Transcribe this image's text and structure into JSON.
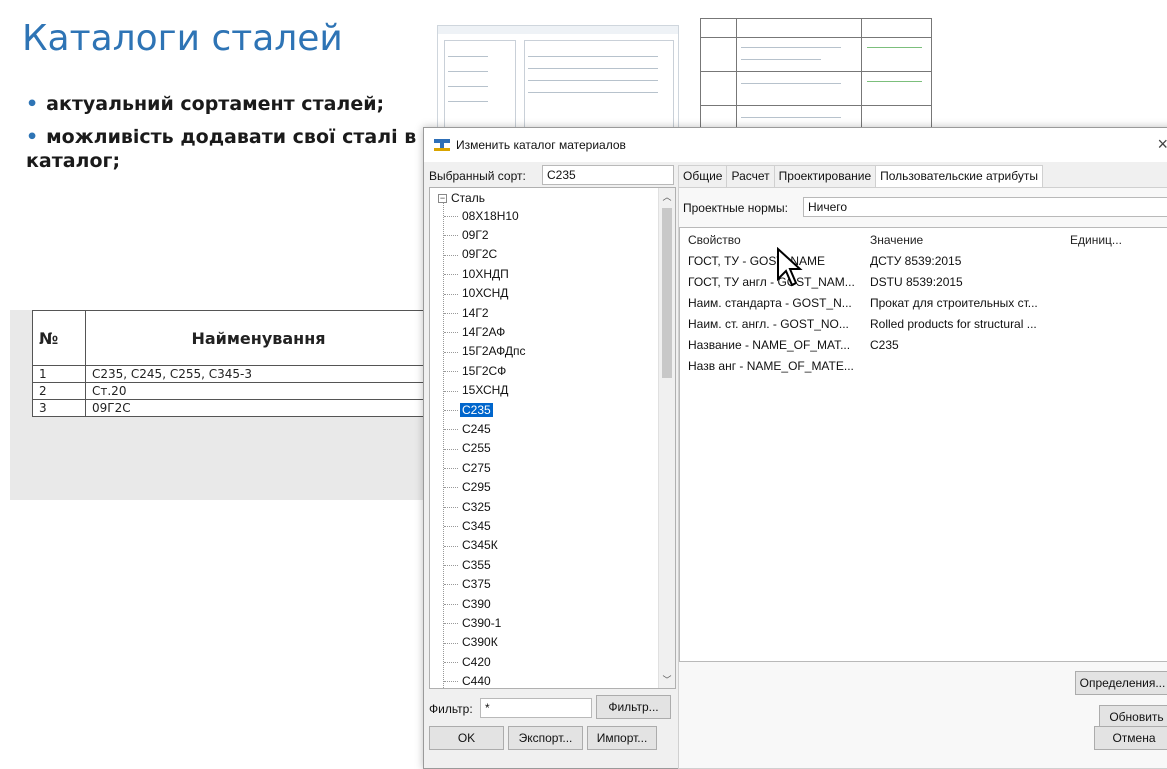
{
  "slide": {
    "title": "Каталоги сталей",
    "bullets": [
      "актуальний сортамент сталей;",
      "можливість додавати свої сталі в каталог;"
    ],
    "table": {
      "headers": [
        "№",
        "Найменування"
      ],
      "rows": [
        [
          "1",
          "С235, С245, С255, С345-3"
        ],
        [
          "2",
          "Ст.20"
        ],
        [
          "3",
          "09Г2С"
        ]
      ]
    }
  },
  "dialog": {
    "title": "Изменить каталог материалов",
    "close_label": "×",
    "selected_label": "Выбранный сорт:",
    "selected_value": "С235",
    "tree": {
      "root": "Сталь",
      "items": [
        "08Х18Н10",
        "09Г2",
        "09Г2С",
        "10ХНДП",
        "10ХСНД",
        "14Г2",
        "14Г2АФ",
        "15Г2АФДпс",
        "15Г2СФ",
        "15ХСНД",
        "С235",
        "С245",
        "С255",
        "С275",
        "С295",
        "С325",
        "С345",
        "С345К",
        "С355",
        "С375",
        "С390",
        "С390-1",
        "С390К",
        "С420",
        "С440"
      ],
      "selected": "С235"
    },
    "tabs": [
      "Общие",
      "Расчет",
      "Проектирование",
      "Пользовательские атрибуты"
    ],
    "active_tab": "Пользовательские атрибуты",
    "norms_label": "Проектные нормы:",
    "norms_value": "Ничего",
    "columns": [
      "Свойство",
      "Значение",
      "Единиц..."
    ],
    "properties": [
      {
        "name": "ГОСТ, ТУ - GOST_NAME",
        "value": "ДСТУ 8539:2015"
      },
      {
        "name": "ГОСТ, ТУ англ - GOST_NAM...",
        "value": "DSTU 8539:2015"
      },
      {
        "name": "Наим. стандарта - GOST_N...",
        "value": "Прокат для строительных ст..."
      },
      {
        "name": "Наим. ст. англ. - GOST_NO...",
        "value": "Rolled products for structural ..."
      },
      {
        "name": "Название - NAME_OF_MAT...",
        "value": "С235"
      },
      {
        "name": "Назв анг - NAME_OF_MATE...",
        "value": ""
      }
    ],
    "filter_label": "Фильтр:",
    "filter_value": "*",
    "filter_button": "Фильтр...",
    "definitions_button": "Определения...",
    "update_button": "Обновить",
    "ok_button": "OK",
    "export_button": "Экспорт...",
    "import_button": "Импорт...",
    "cancel_button": "Отмена"
  }
}
